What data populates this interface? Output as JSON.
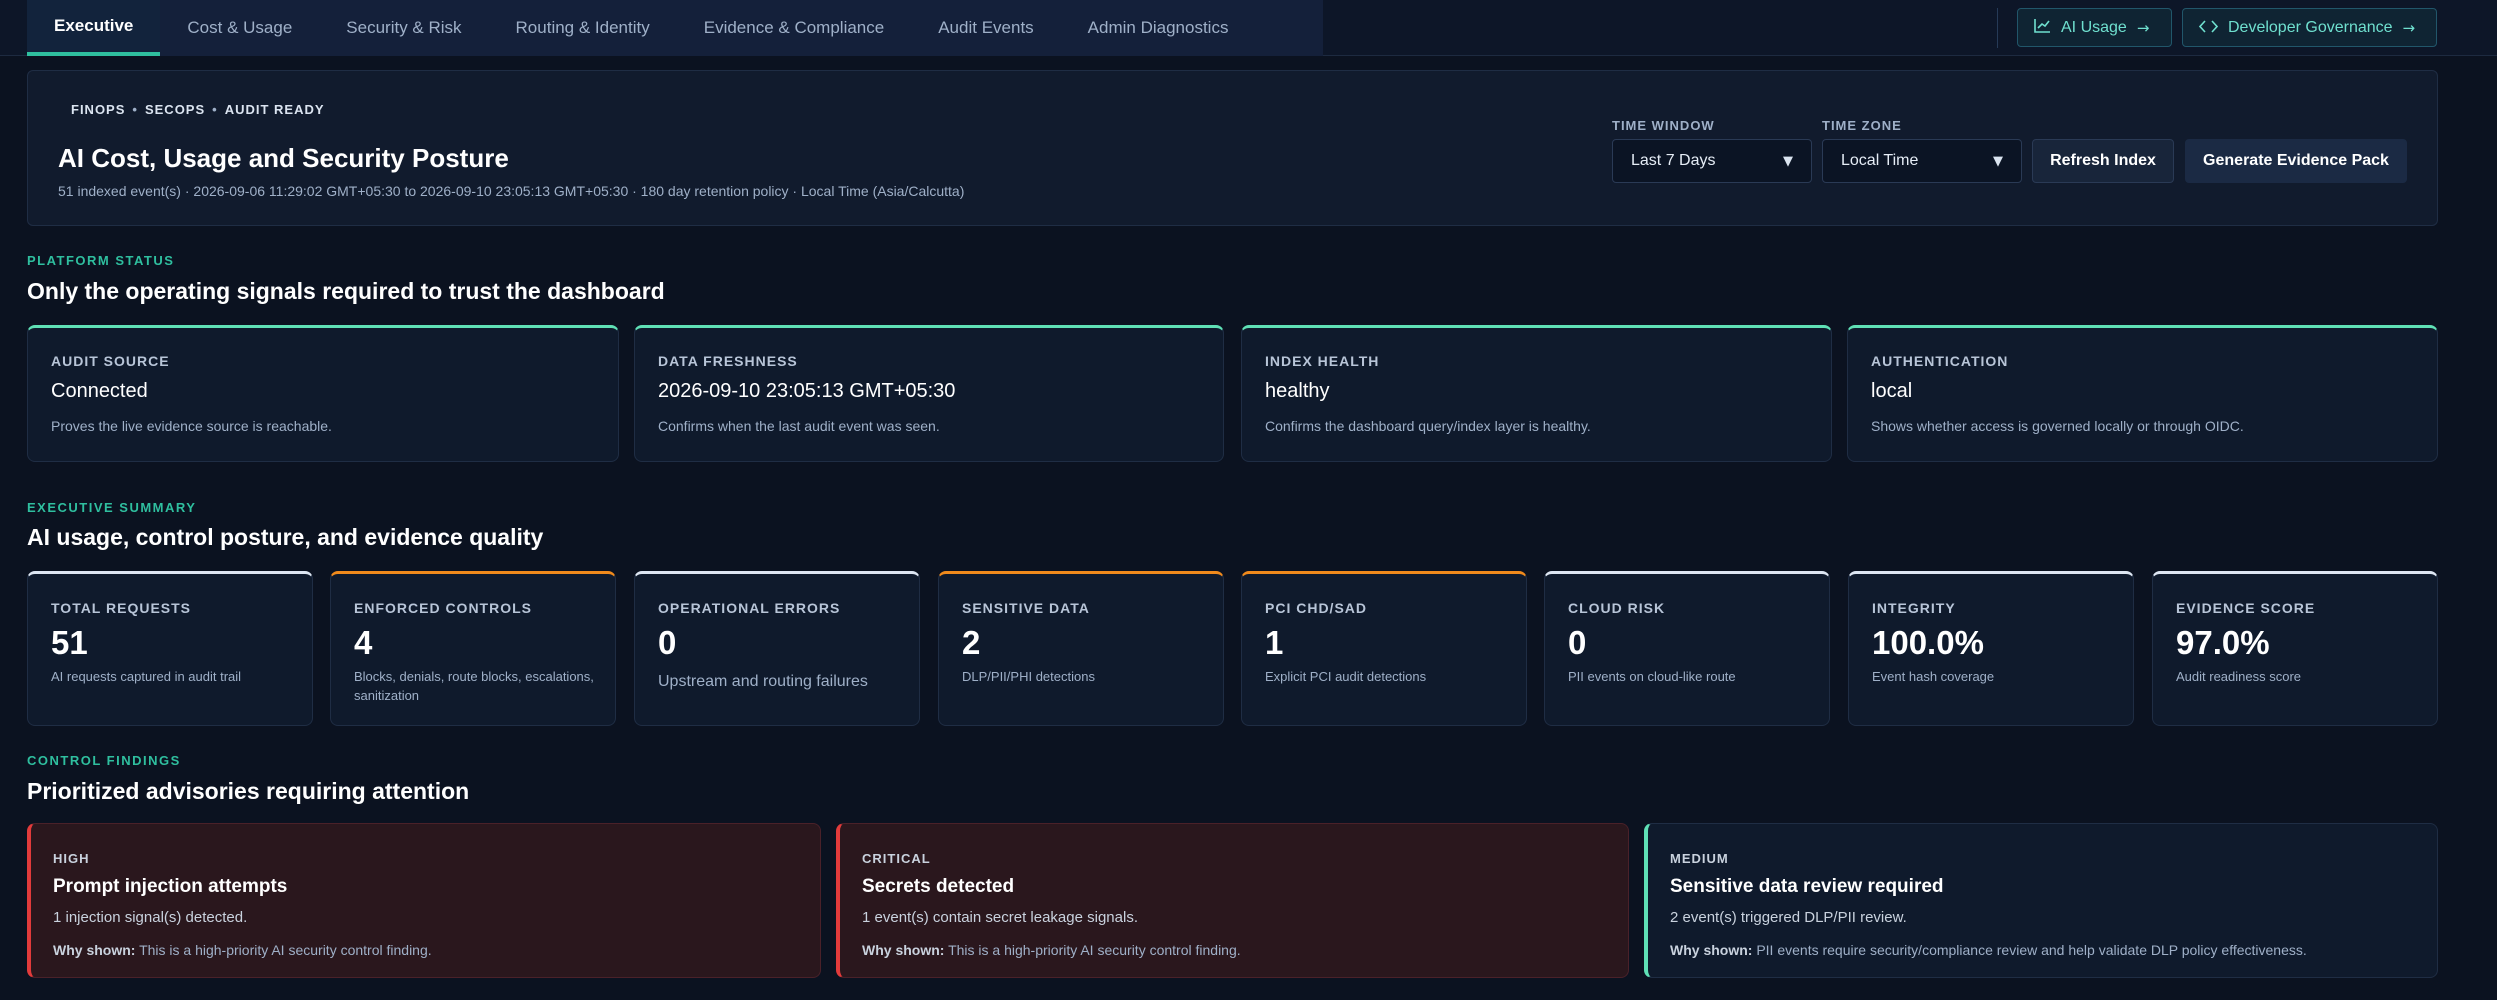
{
  "nav": {
    "tabs": [
      {
        "label": "Executive",
        "active": true
      },
      {
        "label": "Cost & Usage"
      },
      {
        "label": "Security & Risk"
      },
      {
        "label": "Routing & Identity"
      },
      {
        "label": "Evidence & Compliance"
      },
      {
        "label": "Audit Events"
      },
      {
        "label": "Admin Diagnostics"
      }
    ],
    "ai_usage": {
      "label": "AI Usage",
      "icon": "chart-line-icon"
    },
    "dev_gov": {
      "label": "Developer Governance",
      "icon": "code-icon"
    }
  },
  "header": {
    "tags": [
      "FINOPS",
      "SECOPS",
      "AUDIT READY"
    ],
    "title": "AI Cost, Usage and Security Posture",
    "meta": "51 indexed event(s) · 2026-09-06 11:29:02 GMT+05:30 to 2026-09-10 23:05:13 GMT+05:30 · 180 day retention policy · Local Time (Asia/Calcutta)",
    "time_window": {
      "label": "TIME WINDOW",
      "value": "Last 7 Days"
    },
    "time_zone": {
      "label": "TIME ZONE",
      "value": "Local Time"
    },
    "refresh_label": "Refresh Index",
    "generate_label": "Generate Evidence Pack"
  },
  "platform": {
    "eyebrow": "PLATFORM STATUS",
    "title": "Only the operating signals required to trust the dashboard",
    "cards": [
      {
        "label": "AUDIT SOURCE",
        "value": "Connected",
        "desc": "Proves the live evidence source is reachable."
      },
      {
        "label": "DATA FRESHNESS",
        "value": "2026-09-10 23:05:13 GMT+05:30",
        "desc": "Confirms when the last audit event was seen."
      },
      {
        "label": "INDEX HEALTH",
        "value": "healthy",
        "desc": "Confirms the dashboard query/index layer is healthy."
      },
      {
        "label": "AUTHENTICATION",
        "value": "local",
        "desc": "Shows whether access is governed locally or through OIDC."
      }
    ]
  },
  "summary": {
    "eyebrow": "EXECUTIVE SUMMARY",
    "title": "AI usage, control posture, and evidence quality",
    "cards": [
      {
        "label": "TOTAL REQUESTS",
        "value": "51",
        "desc": "AI requests captured in audit trail",
        "accent": "#dde6f2"
      },
      {
        "label": "ENFORCED CONTROLS",
        "value": "4",
        "desc": "Blocks, denials, route blocks, escalations, sanitization",
        "accent": "#f08a1c"
      },
      {
        "label": "OPERATIONAL ERRORS",
        "value": "0",
        "desc": "Upstream and routing failures",
        "accent": "#dde6f2"
      },
      {
        "label": "SENSITIVE DATA",
        "value": "2",
        "desc": "DLP/PII/PHI detections",
        "accent": "#f08a1c"
      },
      {
        "label": "PCI CHD/SAD",
        "value": "1",
        "desc": "Explicit PCI audit detections",
        "accent": "#f08a1c"
      },
      {
        "label": "CLOUD RISK",
        "value": "0",
        "desc": "PII events on cloud-like route",
        "accent": "#dde6f2"
      },
      {
        "label": "INTEGRITY",
        "value": "100.0%",
        "desc": "Event hash coverage",
        "accent": "#dde6f2"
      },
      {
        "label": "EVIDENCE SCORE",
        "value": "97.0%",
        "desc": "Audit readiness score",
        "accent": "#dde6f2"
      }
    ]
  },
  "findings": {
    "eyebrow": "CONTROL FINDINGS",
    "title": "Prioritized advisories requiring attention",
    "why_label": "Why shown:",
    "items": [
      {
        "severity": "HIGH",
        "title": "Prompt injection attempts",
        "desc": "1 injection signal(s) detected.",
        "why": "This is a high-priority AI security control finding.",
        "color": "#e23b3b"
      },
      {
        "severity": "CRITICAL",
        "title": "Secrets detected",
        "desc": "1 event(s) contain secret leakage signals.",
        "why": "This is a high-priority AI security control finding.",
        "color": "#e23b3b"
      },
      {
        "severity": "MEDIUM",
        "title": "Sensitive data review required",
        "desc": "2 event(s) triggered DLP/PII review.",
        "why": "PII events require security/compliance review and help validate DLP policy effectiveness.",
        "color": "#5fe0b5"
      }
    ]
  }
}
